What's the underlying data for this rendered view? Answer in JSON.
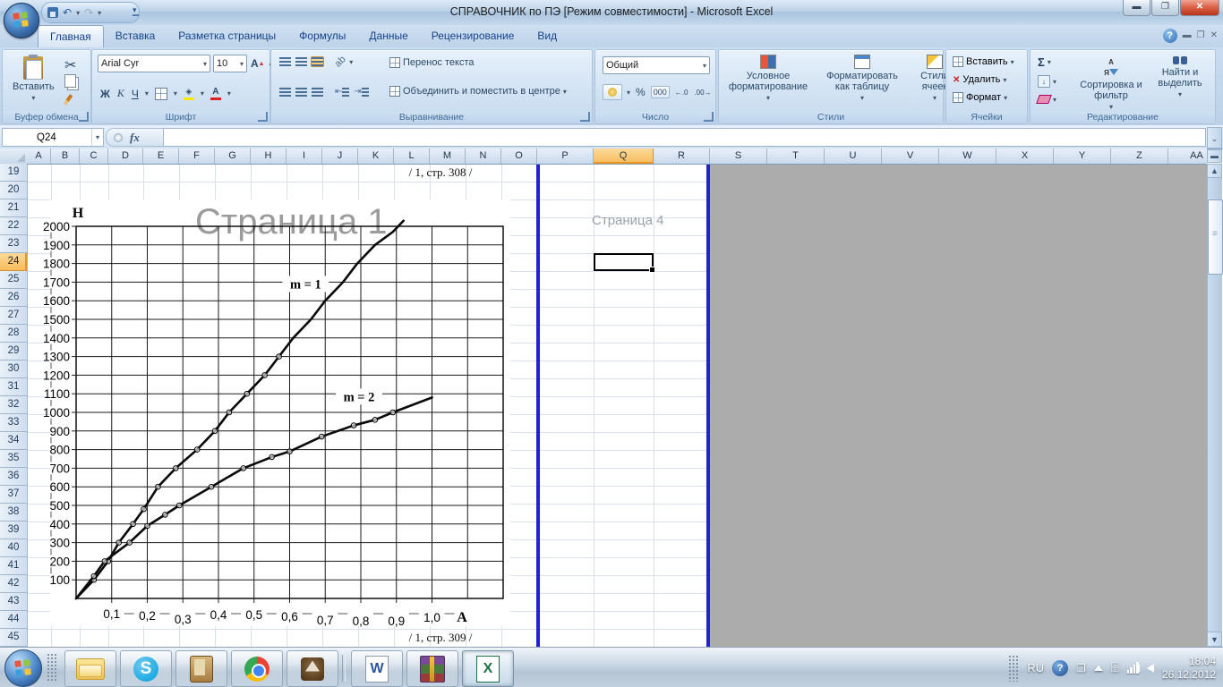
{
  "window": {
    "title": "СПРАВОЧНИК по ПЭ  [Режим совместимости]  -  Microsoft Excel",
    "controls": [
      "minimize",
      "restore",
      "close"
    ]
  },
  "qat": {
    "icons": [
      "office-button",
      "save",
      "undo",
      "redo",
      "customize-quick-access"
    ]
  },
  "ribbon": {
    "active_tab": "Главная",
    "tabs": [
      "Главная",
      "Вставка",
      "Разметка страницы",
      "Формулы",
      "Данные",
      "Рецензирование",
      "Вид"
    ],
    "clipboard": {
      "label": "Буфер обмена",
      "paste": "Вставить"
    },
    "font": {
      "label": "Шрифт",
      "font_name": "Arial Cyr",
      "font_size": "10",
      "bold": "Ж",
      "italic": "К",
      "underline": "Ч",
      "font_color_letter": "А",
      "fill_color_hex": "#ffe800",
      "font_color_hex": "#e02020"
    },
    "alignment": {
      "label": "Выравнивание",
      "wrap": "Перенос текста",
      "merge": "Объединить и поместить в центре"
    },
    "number": {
      "label": "Число",
      "format": "Общий",
      "percent": "%",
      "thousands": "000"
    },
    "styles": {
      "label": "Стили",
      "conditional": "Условное форматирование",
      "format_table": "Форматировать как таблицу",
      "cell_styles": "Стили ячеек"
    },
    "cells": {
      "label": "Ячейки",
      "insert": "Вставить",
      "delete": "Удалить",
      "format": "Формат"
    },
    "editing": {
      "label": "Редактирование",
      "autosum": "Σ",
      "sort": "Сортировка и фильтр",
      "find": "Найти и выделить"
    }
  },
  "formula_bar": {
    "name_box": "Q24",
    "fx": "fx",
    "formula": ""
  },
  "grid": {
    "columns": [
      "A",
      "B",
      "C",
      "D",
      "E",
      "F",
      "G",
      "H",
      "I",
      "J",
      "K",
      "L",
      "M",
      "N",
      "O",
      "P",
      "Q",
      "R",
      "S",
      "T",
      "U",
      "V",
      "W",
      "X",
      "Y",
      "Z",
      "AA"
    ],
    "rows": [
      19,
      20,
      21,
      22,
      23,
      24,
      25,
      26,
      27,
      28,
      29,
      30,
      31,
      32,
      33,
      34,
      35,
      36,
      37,
      38,
      39,
      40,
      41,
      42,
      43,
      44,
      45
    ],
    "selected_cell": "Q24",
    "selected_column": "Q",
    "selected_row": 24
  },
  "sheet": {
    "ref_top": "/ 1, стр. 308 /",
    "ref_bottom": "/ 1, стр. 309 /",
    "watermark_large": "Страница 1",
    "watermark_small": "Страница 4",
    "page_break_color": "#2323cd",
    "outside_area_color": "#acacac"
  },
  "chart_data": {
    "type": "line",
    "title": "",
    "xlabel": "A",
    "ylabel": "H",
    "xlim": [
      0,
      1.2
    ],
    "ylim": [
      0,
      2000
    ],
    "grid": "major black grid on, both axes",
    "legend_position": "inline labels",
    "x_ticks": [
      0.1,
      0.2,
      0.3,
      0.4,
      0.5,
      0.6,
      0.7,
      0.8,
      0.9,
      1.0
    ],
    "x_tick_labels": [
      "0,1",
      "0,2",
      "0,3",
      "0,4",
      "0,5",
      "0,6",
      "0,7",
      "0,8",
      "0,9",
      "1,0"
    ],
    "y_ticks": [
      100,
      200,
      300,
      400,
      500,
      600,
      700,
      800,
      900,
      1000,
      1100,
      1200,
      1300,
      1400,
      1500,
      1600,
      1700,
      1800,
      1900,
      2000
    ],
    "series": [
      {
        "name": "m = 1",
        "label_pos": [
          0.645,
          1690
        ],
        "points": [
          [
            0,
            0
          ],
          [
            0.05,
            100
          ],
          [
            0.09,
            200
          ],
          [
            0.12,
            300
          ],
          [
            0.16,
            400
          ],
          [
            0.19,
            480
          ],
          [
            0.23,
            600
          ],
          [
            0.28,
            700
          ],
          [
            0.34,
            800
          ],
          [
            0.39,
            900
          ],
          [
            0.43,
            1000
          ],
          [
            0.48,
            1100
          ],
          [
            0.53,
            1200
          ],
          [
            0.57,
            1300
          ],
          [
            0.61,
            1400
          ],
          [
            0.66,
            1500
          ],
          [
            0.7,
            1600
          ],
          [
            0.75,
            1700
          ],
          [
            0.79,
            1800
          ],
          [
            0.84,
            1900
          ],
          [
            0.89,
            1970
          ],
          [
            0.92,
            2030
          ]
        ]
      },
      {
        "name": "m = 2",
        "label_pos": [
          0.795,
          1085
        ],
        "points": [
          [
            0,
            0
          ],
          [
            0.05,
            120
          ],
          [
            0.08,
            200
          ],
          [
            0.15,
            300
          ],
          [
            0.2,
            390
          ],
          [
            0.25,
            450
          ],
          [
            0.29,
            500
          ],
          [
            0.38,
            600
          ],
          [
            0.47,
            700
          ],
          [
            0.55,
            760
          ],
          [
            0.6,
            790
          ],
          [
            0.69,
            870
          ],
          [
            0.78,
            930
          ],
          [
            0.84,
            960
          ],
          [
            0.89,
            1000
          ],
          [
            1.0,
            1080
          ]
        ]
      }
    ]
  },
  "taskbar": {
    "lang": "RU",
    "time": "18:04",
    "date": "26.12.2012",
    "app_icons": [
      "explorer",
      "skype",
      "scroll",
      "chrome",
      "ship",
      "word",
      "winrar",
      "excel"
    ],
    "active_app": "excel",
    "tray_icons": [
      "language-RU",
      "help-badge",
      "window-restore",
      "show-hidden-triangle",
      "power-plug",
      "network-signal",
      "volume"
    ]
  }
}
